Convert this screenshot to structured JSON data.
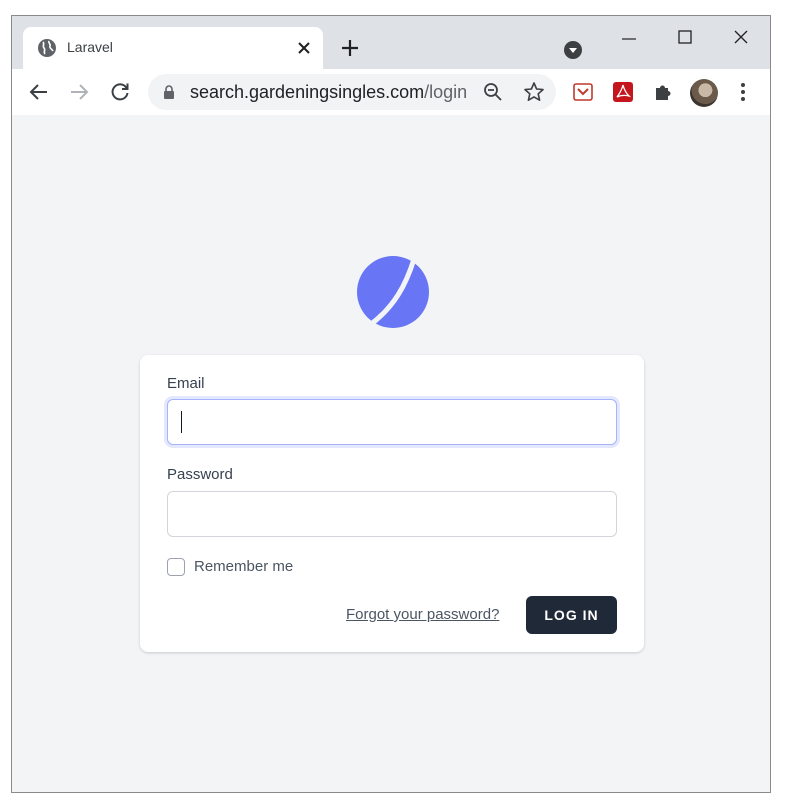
{
  "browser": {
    "tab": {
      "title": "Laravel"
    },
    "address_bar": {
      "host": "search.gardeningsingles.com",
      "path": "/login"
    }
  },
  "login_form": {
    "email_label": "Email",
    "email_value": "",
    "password_label": "Password",
    "password_value": "",
    "remember_label": "Remember me",
    "remember_checked": false,
    "forgot_link": "Forgot your password?",
    "login_button": "LOG IN"
  },
  "colors": {
    "logo": "#6875f5",
    "button": "#1f2937",
    "page_bg": "#f3f4f6"
  }
}
